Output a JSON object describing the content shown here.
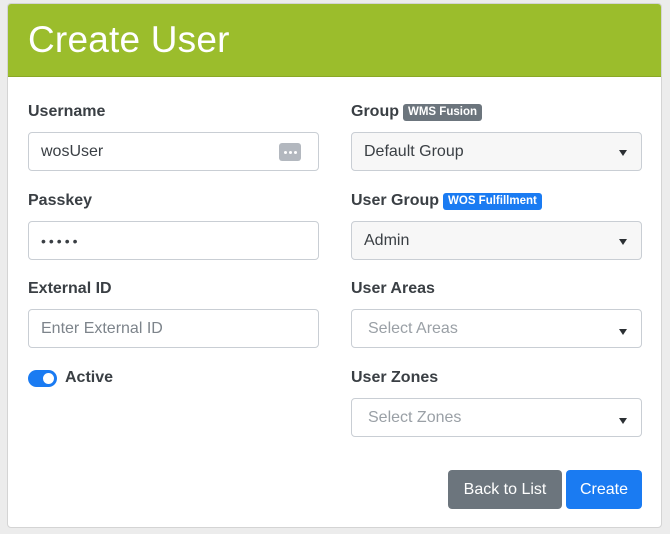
{
  "header": {
    "title": "Create User"
  },
  "form": {
    "username": {
      "label": "Username",
      "value": "wosUser",
      "icon": "password-manager-icon"
    },
    "passkey": {
      "label": "Passkey",
      "value": "•••••"
    },
    "external_id": {
      "label": "External ID",
      "placeholder": "Enter External ID"
    },
    "active": {
      "label": "Active",
      "checked": true
    },
    "group": {
      "label": "Group",
      "badge": "WMS Fusion",
      "value": "Default Group"
    },
    "user_group": {
      "label": "User Group",
      "badge": "WOS Fulfillment",
      "value": "Admin"
    },
    "user_areas": {
      "label": "User Areas",
      "placeholder": "Select Areas"
    },
    "user_zones": {
      "label": "User Zones",
      "placeholder": "Select Zones"
    }
  },
  "actions": {
    "back_label": "Back to List",
    "create_label": "Create"
  },
  "colors": {
    "header_bg": "#9bbd2c",
    "primary": "#1a7bf2",
    "secondary": "#6c757d"
  }
}
